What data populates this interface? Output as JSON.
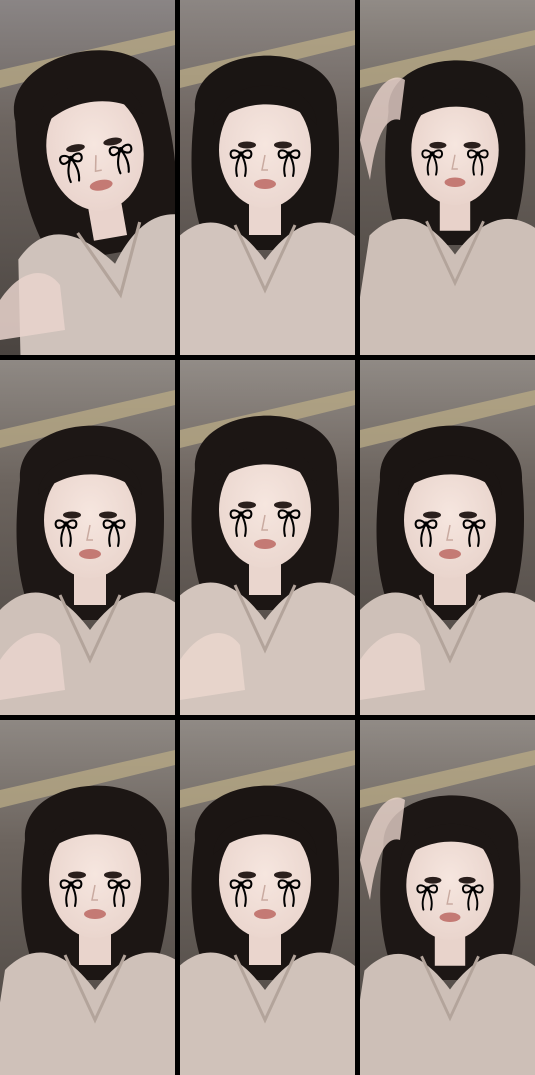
{
  "frames": [
    {
      "id": "frame-1",
      "tone": "#6d6560",
      "wall": "#8a8585",
      "skin": "#e9d3cc",
      "hair": "#1c1614",
      "shirt": "#cfc2bb"
    },
    {
      "id": "frame-2",
      "tone": "#6f6661",
      "wall": "#8c8683",
      "skin": "#ead6cf",
      "hair": "#1a1513",
      "shirt": "#d2c4bd"
    },
    {
      "id": "frame-3",
      "tone": "#6a625c",
      "wall": "#918b86",
      "skin": "#e8d2ca",
      "hair": "#1b1614",
      "shirt": "#cdbfb7"
    },
    {
      "id": "frame-4",
      "tone": "#6c645e",
      "wall": "#8f8984",
      "skin": "#e9d4cc",
      "hair": "#1d1715",
      "shirt": "#cfc1b9"
    },
    {
      "id": "frame-5",
      "tone": "#6e655f",
      "wall": "#928c87",
      "skin": "#ead6ce",
      "hair": "#1c1614",
      "shirt": "#d3c5bd"
    },
    {
      "id": "frame-6",
      "tone": "#6b635d",
      "wall": "#908a85",
      "skin": "#e8d3cb",
      "hair": "#1b1513",
      "shirt": "#cec0b8"
    },
    {
      "id": "frame-7",
      "tone": "#6c645e",
      "wall": "#8e8883",
      "skin": "#e9d4cc",
      "hair": "#1c1614",
      "shirt": "#cfc1b9"
    },
    {
      "id": "frame-8",
      "tone": "#6d655f",
      "wall": "#908a85",
      "skin": "#ead5cd",
      "hair": "#1b1513",
      "shirt": "#d0c2ba"
    },
    {
      "id": "frame-9",
      "tone": "#6b635d",
      "wall": "#918b86",
      "skin": "#e8d3cb",
      "hair": "#1d1715",
      "shirt": "#cdbfb7"
    }
  ],
  "stickers": {
    "icon": "crying-bow-icon",
    "color": "#000000"
  }
}
